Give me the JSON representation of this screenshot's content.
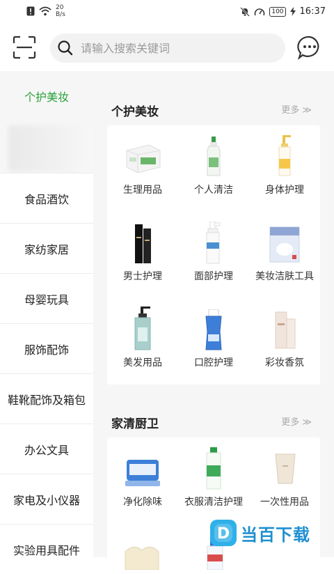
{
  "status_bar": {
    "speed_value": "20",
    "speed_unit": "B/s",
    "battery": "100",
    "time": "16:37"
  },
  "header": {
    "search_placeholder": "请输入搜索关键词",
    "icons": [
      "scan-icon",
      "search-icon",
      "message-icon"
    ]
  },
  "sidebar": {
    "active": "个护美妆",
    "items": [
      "食品酒饮",
      "家纺家居",
      "母婴玩具",
      "服饰配饰",
      "鞋靴配饰及箱包",
      "办公文具",
      "家电及小仪器",
      "实验用具配件"
    ],
    "active_color": "#2aa13a"
  },
  "sections": [
    {
      "title": "个护美妆",
      "more": "更多 ≫",
      "items": [
        "生理用品",
        "个人清洁",
        "身体护理",
        "男士护理",
        "面部护理",
        "美妆洁肤工具",
        "美发用品",
        "口腔护理",
        "彩妆香氛"
      ]
    },
    {
      "title": "家清厨卫",
      "more": "更多 ≫",
      "items": [
        "净化除味",
        "衣服清洁护理",
        "一次性用品"
      ]
    }
  ],
  "watermark": {
    "text": "当百下载",
    "logo_letter": "D"
  }
}
